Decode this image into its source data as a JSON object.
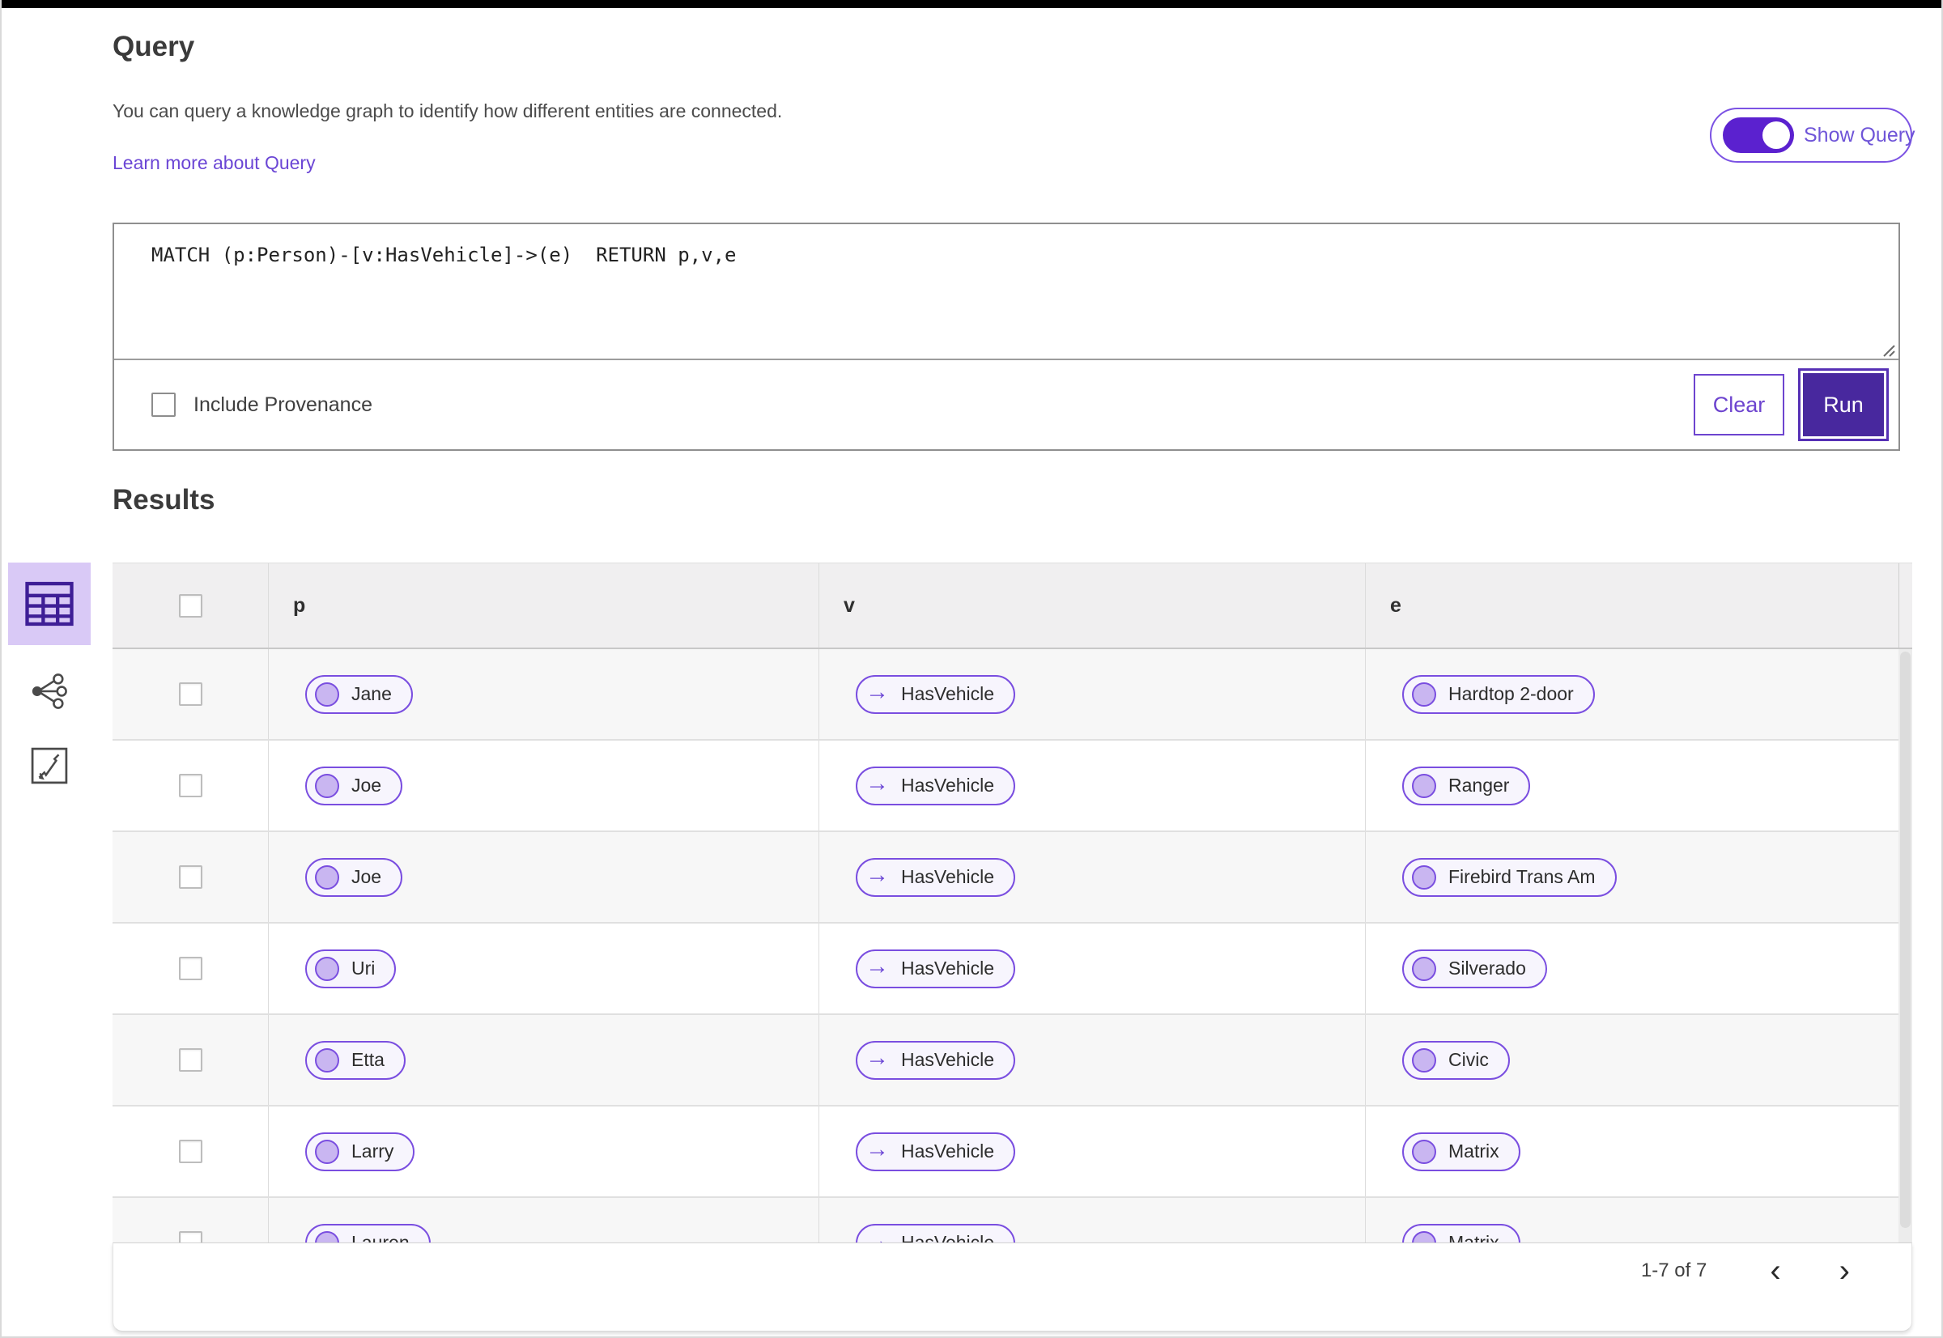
{
  "query": {
    "title": "Query",
    "description": "You can query a knowledge graph to identify how different entities are connected.",
    "learn_more_link": "Learn more about Query",
    "show_query_toggle": {
      "label": "Show Query",
      "state": "on"
    },
    "editor": {
      "value": "MATCH (p:Person)-[v:HasVehicle]->(e)  RETURN p,v,e"
    },
    "include_provenance": {
      "label": "Include Provenance",
      "checked": false
    },
    "buttons": {
      "clear": "Clear",
      "run": "Run"
    }
  },
  "results": {
    "title": "Results",
    "view_rail": [
      {
        "name": "table-view",
        "selected": true
      },
      {
        "name": "graph-view",
        "selected": false
      },
      {
        "name": "scatter-view",
        "selected": false
      }
    ],
    "table": {
      "columns": [
        "p",
        "v",
        "e"
      ],
      "rows": [
        {
          "p": "Jane",
          "v": "HasVehicle",
          "e": "Hardtop 2-door"
        },
        {
          "p": "Joe",
          "v": "HasVehicle",
          "e": "Ranger"
        },
        {
          "p": "Joe",
          "v": "HasVehicle",
          "e": "Firebird Trans Am"
        },
        {
          "p": "Uri",
          "v": "HasVehicle",
          "e": "Silverado"
        },
        {
          "p": "Etta",
          "v": "HasVehicle",
          "e": "Civic"
        },
        {
          "p": "Larry",
          "v": "HasVehicle",
          "e": "Matrix"
        },
        {
          "p": "Lauren",
          "v": "HasVehicle",
          "e": "Matrix"
        }
      ]
    },
    "pagination": {
      "range_label": "1-7 of 7"
    }
  },
  "icons": {
    "edge_arrow": "→",
    "chevron_left": "‹",
    "chevron_right": "›"
  },
  "colors": {
    "accent": "#6b46d5",
    "pill_border": "#7a4ee0",
    "pill_bg": "#f7f5fd",
    "node_fill": "#c9b6f1",
    "run_button": "#48289e",
    "toggle_track": "#5b21cf",
    "selected_view_bg": "#d9c9f6",
    "header_bg": "#f0eff0",
    "row_alt_bg": "#f7f7f7",
    "top_bar": "#000000"
  }
}
